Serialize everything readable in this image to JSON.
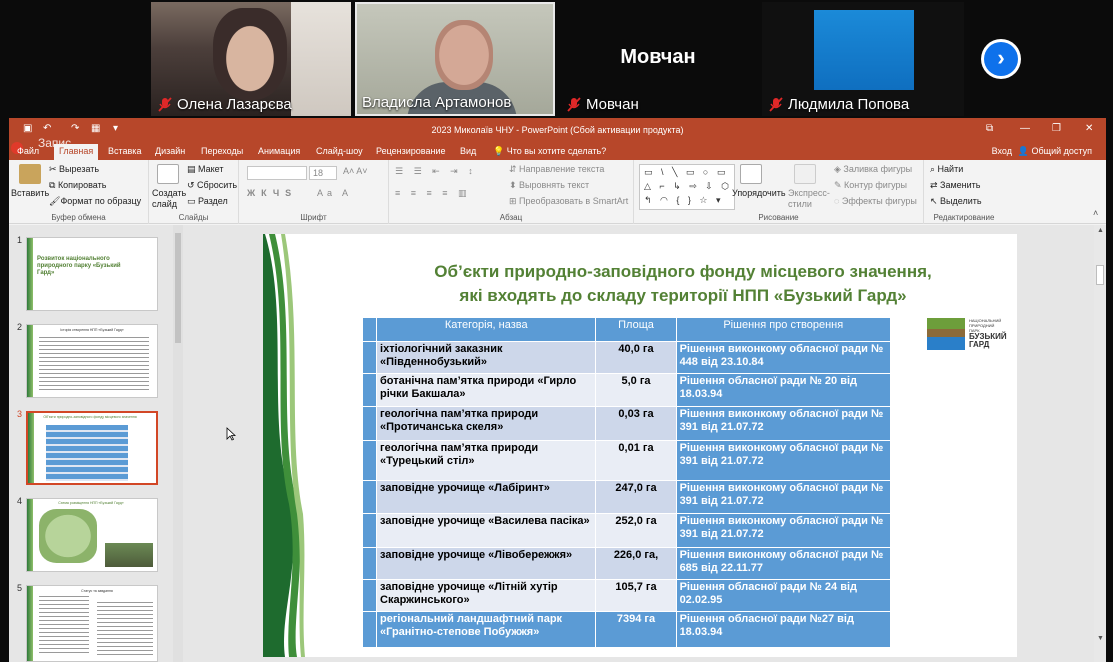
{
  "participants": [
    {
      "name": "Олена Лазарєва",
      "muted": true
    },
    {
      "name": "Владисла Артамонов",
      "muted": false
    },
    {
      "name": "Мовчан",
      "muted": true,
      "avatar_text": "Мовчан"
    },
    {
      "name": "Людмила Попова",
      "muted": true
    }
  ],
  "ppt": {
    "window_title": "2023 Миколаїв ЧНУ - PowerPoint (Сбой активации продукта)",
    "overlay_text": "Запис",
    "tabs": [
      "Файл",
      "Главная",
      "Вставка",
      "Дизайн",
      "Переходы",
      "Анимация",
      "Слайд-шоу",
      "Рецензирование",
      "Вид"
    ],
    "active_tab": "Главная",
    "tell_me": "Что вы хотите сделать?",
    "sign_in": "Вход",
    "share": "Общий доступ",
    "ribbon": {
      "paste": "Вставить",
      "cut": "Вырезать",
      "copy": "Копировать",
      "format_painter": "Формат по образцу",
      "clipboard_group": "Буфер обмена",
      "new_slide": "Создать слайд",
      "layout": "Макет",
      "reset": "Сбросить",
      "section": "Раздел",
      "slides_group": "Слайды",
      "font_size": "18",
      "font_group": "Шрифт",
      "text_direction": "Направление текста",
      "align_text": "Выровнять текст",
      "smartart": "Преобразовать в SmartArt",
      "paragraph_group": "Абзац",
      "arrange": "Упорядочить",
      "quick_styles": "Экспресс-стили",
      "shape_fill": "Заливка фигуры",
      "shape_outline": "Контур фигуры",
      "shape_effects": "Эффекты фигуры",
      "drawing_group": "Рисование",
      "find": "Найти",
      "replace": "Заменить",
      "select": "Выделить",
      "editing_group": "Редактирование"
    },
    "thumbnails": [
      {
        "num": "1",
        "title": "Розвиток національного природного парку «Бузький Гард»"
      },
      {
        "num": "2",
        "title": "Історія створення НПП «Бузький Гард»"
      },
      {
        "num": "3",
        "title": "Об’єкти природно-заповідного фонду місцевого значення"
      },
      {
        "num": "4",
        "title": "Схема розміщення НПП «Бузький Гард»"
      },
      {
        "num": "5",
        "title": "Статус та завдання"
      }
    ],
    "selected_slide": "3"
  },
  "slide": {
    "title_line1": "Об’єкти природно-заповідного фонду місцевого значення,",
    "title_line2": "які  входять до складу території НПП «Бузький Гард»",
    "logo_small": "НАЦІОНАЛЬНИЙ ПРИРОДНИЙ ПАРК",
    "logo_big": "БУЗЬКИЙ ГАРД",
    "headers": [
      "Категорія, назва",
      "Площа",
      "Рішення про створення"
    ],
    "rows": [
      {
        "name": "іхтіологічний заказник «Південнобузький»",
        "area": "40,0 га",
        "decision": "Рішення виконкому обласної ради № 448 від 23.10.84"
      },
      {
        "name": "ботанічна пам’ятка природи «Гирло річки Бакшала»",
        "area": "5,0 га",
        "decision": "Рішення обласної ради № 20 від 18.03.94"
      },
      {
        "name": "геологічна пам’ятка природи «Протичанська скеля»",
        "area": "0,03 га",
        "decision": "Рішення виконкому обласної ради № 391 від 21.07.72"
      },
      {
        "name": "геологічна пам’ятка природи «Турецький стіл»",
        "area": "0,01 га",
        "decision": "Рішення виконкому обласної ради № 391 від 21.07.72"
      },
      {
        "name": "заповідне урочище «Лабіринт»",
        "area": "247,0 га",
        "decision": "Рішення виконкому обласної ради № 391 від 21.07.72"
      },
      {
        "name": "заповідне урочище «Василева пасіка»",
        "area": "252,0 га",
        "decision": "Рішення виконкому обласної ради № 391 від 21.07.72"
      },
      {
        "name": "заповідне урочище «Лівобережжя»",
        "area": "226,0 га,",
        "decision": "Рішення виконкому обласної ради № 685 від 22.11.77"
      },
      {
        "name": "заповідне урочище «Літній хутір Скаржинського»",
        "area": "105,7 га",
        "decision": "Рішення обласної ради № 24 від 02.02.95"
      },
      {
        "name": "регіональний ландшафтний парк «Гранітно-степове Побужжя»",
        "area": "7394 га",
        "decision": "Рішення обласної ради №27 від 18.03.94"
      }
    ]
  }
}
